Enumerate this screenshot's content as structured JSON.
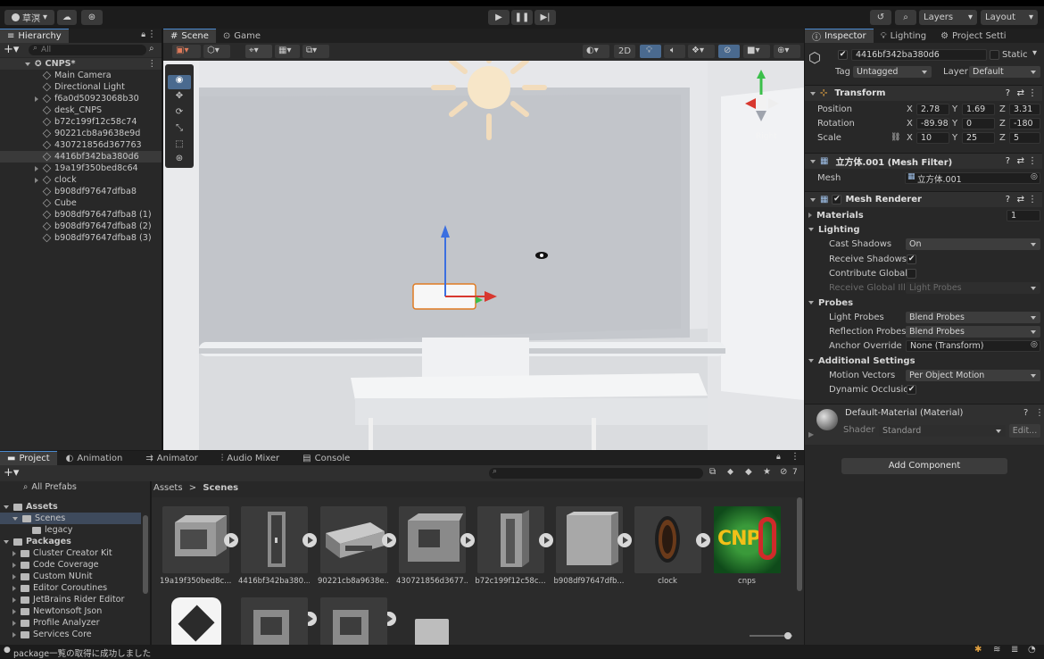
{
  "topbar": {
    "account": "草溟",
    "layers": "Layers",
    "layout": "Layout"
  },
  "hierarchy": {
    "tab": "Hierarchy",
    "search_placeholder": "All",
    "scene": "CNPS*",
    "items": [
      {
        "label": "Main Camera",
        "expand": false
      },
      {
        "label": "Directional Light",
        "expand": false
      },
      {
        "label": "f6a0d50923068b30",
        "expand": true
      },
      {
        "label": "desk_CNPS",
        "expand": false
      },
      {
        "label": "b72c199f12c58c74",
        "expand": false
      },
      {
        "label": "90221cb8a9638e9d",
        "expand": false
      },
      {
        "label": "430721856d367763",
        "expand": false
      },
      {
        "label": "4416bf342ba380d6",
        "expand": false,
        "selected": true
      },
      {
        "label": "19a19f350bed8c64",
        "expand": true
      },
      {
        "label": "clock",
        "expand": true
      },
      {
        "label": "b908df97647dfba8",
        "expand": false
      },
      {
        "label": "Cube",
        "expand": false
      },
      {
        "label": "b908df97647dfba8 (1)",
        "expand": false
      },
      {
        "label": "b908df97647dfba8 (2)",
        "expand": false
      },
      {
        "label": "b908df97647dfba8 (3)",
        "expand": false
      }
    ]
  },
  "scene_tabs": {
    "scene": "Scene",
    "game": "Game"
  },
  "scene_toolbar": {
    "mode_2d": "2D"
  },
  "gizmo": {
    "label": "Right"
  },
  "inspector": {
    "tabs": [
      "Inspector",
      "Lighting",
      "Project Setti"
    ],
    "object_name": "4416bf342ba380d6",
    "static_label": "Static",
    "tag_label": "Tag",
    "tag_value": "Untagged",
    "layer_label": "Layer",
    "layer_value": "Default",
    "transform": {
      "title": "Transform",
      "position_label": "Position",
      "rotation_label": "Rotation",
      "scale_label": "Scale",
      "position": [
        "2.78",
        "1.69",
        "3.31"
      ],
      "rotation": [
        "-89.98",
        "0",
        "-180"
      ],
      "scale": [
        "10",
        "25",
        "5"
      ]
    },
    "mesh_filter": {
      "title": "立方体.001 (Mesh Filter)",
      "mesh_label": "Mesh",
      "mesh_value": "立方体.001"
    },
    "mesh_renderer": {
      "title": "Mesh Renderer",
      "materials_label": "Materials",
      "materials_count": "1",
      "lighting_label": "Lighting",
      "cast_shadows_label": "Cast Shadows",
      "cast_shadows_value": "On",
      "receive_shadows_label": "Receive Shadows",
      "contribute_gi_label": "Contribute Global I",
      "receive_gi_label": "Receive Global Illu",
      "receive_gi_value": "Light Probes",
      "probes_label": "Probes",
      "light_probes_label": "Light Probes",
      "light_probes_value": "Blend Probes",
      "reflection_probes_label": "Reflection Probes",
      "reflection_probes_value": "Blend Probes",
      "anchor_override_label": "Anchor Override",
      "anchor_override_value": "None (Transform)",
      "additional_label": "Additional Settings",
      "motion_vectors_label": "Motion Vectors",
      "motion_vectors_value": "Per Object Motion",
      "dynamic_occlusion_label": "Dynamic Occlusio"
    },
    "material": {
      "title": "Default-Material (Material)",
      "shader_label": "Shader",
      "shader_value": "Standard",
      "edit_label": "Edit..."
    },
    "add_component": "Add Component"
  },
  "bottom_tabs": [
    "Project",
    "Animation",
    "Animator",
    "Audio Mixer",
    "Console"
  ],
  "project": {
    "hidden_count": "7",
    "tree_top": "All Prefabs",
    "assets": "Assets",
    "scenes": "Scenes",
    "legacy": "legacy",
    "packages": "Packages",
    "package_items": [
      "Cluster Creator Kit",
      "Code Coverage",
      "Custom NUnit",
      "Editor Coroutines",
      "JetBrains Rider Editor",
      "Newtonsoft Json",
      "Profile Analyzer",
      "Services Core"
    ],
    "breadcrumb": [
      "Assets",
      "Scenes"
    ],
    "asset_items": [
      "19a19f350bed8c...",
      "4416bf342ba380...",
      "90221cb8a9638e...",
      "430721856d3677...",
      "b72c199f12c58c...",
      "b908df97647dfb...",
      "clock",
      "cnps"
    ],
    "cnps_logo_text": "CNP"
  },
  "status_bar": "package一覧の取得に成功しました",
  "colors": {
    "accent": "#4a8ad0",
    "selection": "#3e4a5c",
    "panel": "#282828",
    "header": "#1f1f1f"
  }
}
